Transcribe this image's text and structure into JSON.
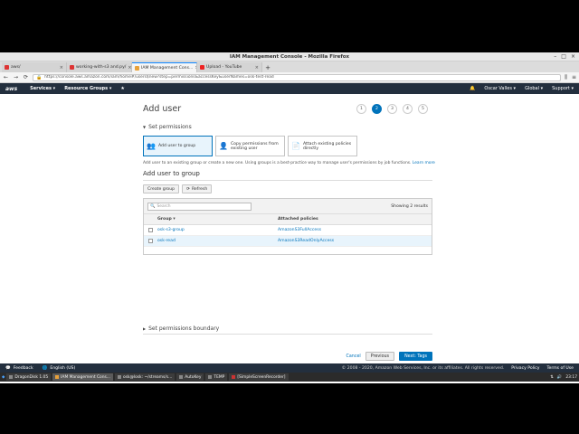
{
  "window": {
    "title": "IAM Management Console - Mozilla Firefox"
  },
  "tabs": [
    {
      "label": "aws/",
      "color": "#d33"
    },
    {
      "label": "working-with-s3 and.py/",
      "color": "#d33"
    },
    {
      "label": "IAM Management Cons...",
      "color": "#e8a13a",
      "active": true
    },
    {
      "label": "Upload - YouTube",
      "color": "#e22"
    }
  ],
  "url": "https://console.aws.amazon.com/iam/home#/users$new?step=permissions&accessKey&userNames=osk-test-read",
  "aws_header": {
    "logo": "aws",
    "services": "Services ▾",
    "resource_groups": "Resource Groups ▾",
    "star": "★",
    "bell": "🔔",
    "user": "Oscar Valles ▾",
    "region": "Global ▾",
    "support": "Support ▾"
  },
  "page": {
    "title": "Add user",
    "steps": [
      "1",
      "2",
      "3",
      "4",
      "5"
    ],
    "active_step": "2",
    "set_permissions": "Set permissions",
    "options": [
      {
        "label": "Add user to group",
        "icon": "group-icon",
        "selected": true
      },
      {
        "label": "Copy permissions from existing user",
        "icon": "user-icon",
        "selected": false
      },
      {
        "label": "Attach existing policies directly",
        "icon": "document-icon",
        "selected": false
      }
    ],
    "description": "Add user to an existing group or create a new one. Using groups is a best-practice way to manage user's permissions by job functions.",
    "learn_more": "Learn more",
    "subtitle": "Add user to group",
    "create_group": "Create group",
    "refresh": "Refresh",
    "search_placeholder": "Search",
    "showing": "Showing 2 results",
    "columns": [
      "Group ▾",
      "Attached policies"
    ],
    "rows": [
      {
        "group": "osk-s3-group",
        "policy": "AmazonS3FullAccess"
      },
      {
        "group": "osk-read",
        "policy": "AmazonS3ReadOnlyAccess"
      }
    ],
    "boundary": "Set permissions boundary",
    "cancel": "Cancel",
    "previous": "Previous",
    "next": "Next: Tags"
  },
  "aws_footer": {
    "feedback": "Feedback",
    "language": "English (US)",
    "copyright": "© 2008 - 2020, Amazon Web Services, Inc. or its affiliates. All rights reserved.",
    "privacy": "Privacy Policy",
    "terms": "Terms of Use"
  },
  "taskbar": {
    "items": [
      "DragonDisk 1.05",
      "IAM Management Cons...",
      "osk@losk: ~/streams/s...",
      "AutoKey",
      "TEMP",
      "[SimpleScreenRecorder]"
    ],
    "clock": "23:17"
  }
}
